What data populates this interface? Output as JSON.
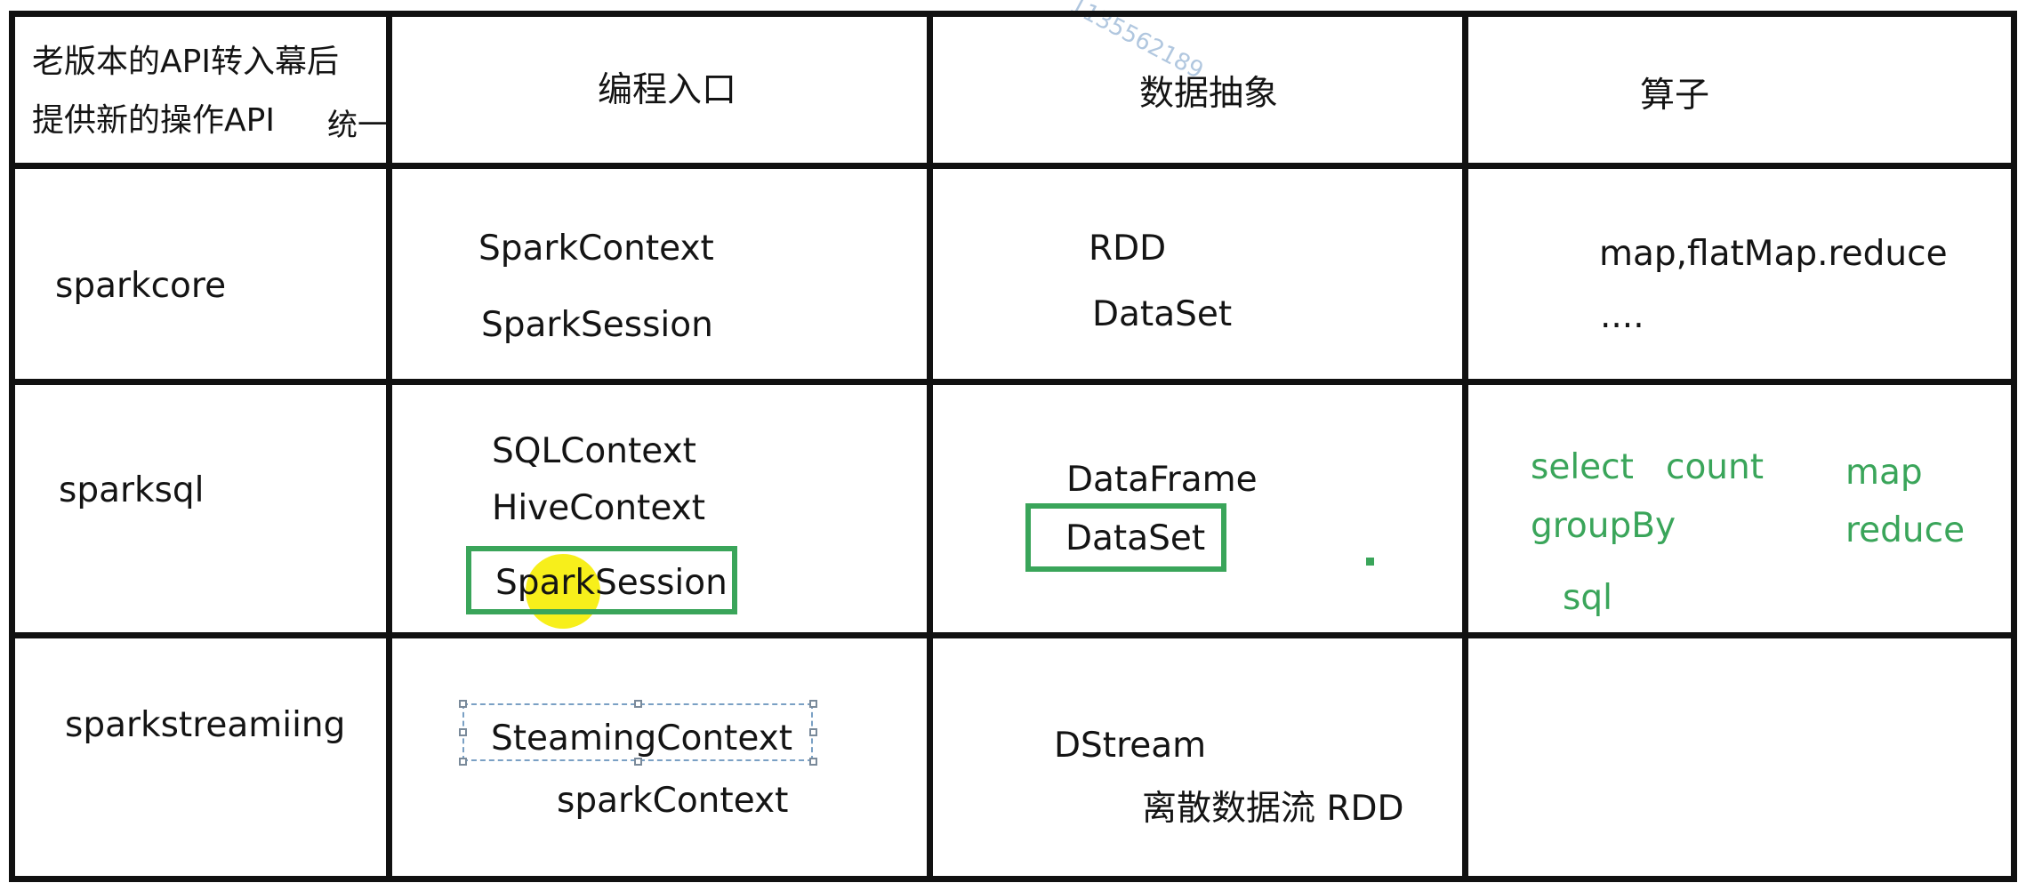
{
  "watermark": "1135562189",
  "header": {
    "corner_line1": "老版本的API转入幕后",
    "corner_line2": "提供新的操作API",
    "corner_unify": "统一",
    "col_entry": "编程入口",
    "col_abstraction": "数据抽象",
    "col_operator": "算子"
  },
  "rows": {
    "core": {
      "name": "sparkcore",
      "entry1": "SparkContext",
      "entry2": "SparkSession",
      "abs1": "RDD",
      "abs2": "DataSet",
      "op1": "map,flatMap.reduce",
      "op2": "...."
    },
    "sql": {
      "name": "sparksql",
      "entry1": "SQLContext",
      "entry2": "HiveContext",
      "entry3": "SparkSession",
      "abs1": "DataFrame",
      "abs2": "DataSet",
      "ops": {
        "select": "select",
        "count": "count",
        "map": "map",
        "groupBy": "groupBy",
        "reduce": "reduce",
        "sql": "sql"
      }
    },
    "streaming": {
      "name": "sparkstreamiing",
      "entry1": "SteamingContext",
      "entry2": "sparkContext",
      "abs1": "DStream",
      "abs2": "离散数据流 RDD"
    }
  },
  "colors": {
    "highlight_box": "#3aa55a",
    "operator_text": "#3aa55a",
    "cursor_highlight": "#f7ef1b"
  }
}
